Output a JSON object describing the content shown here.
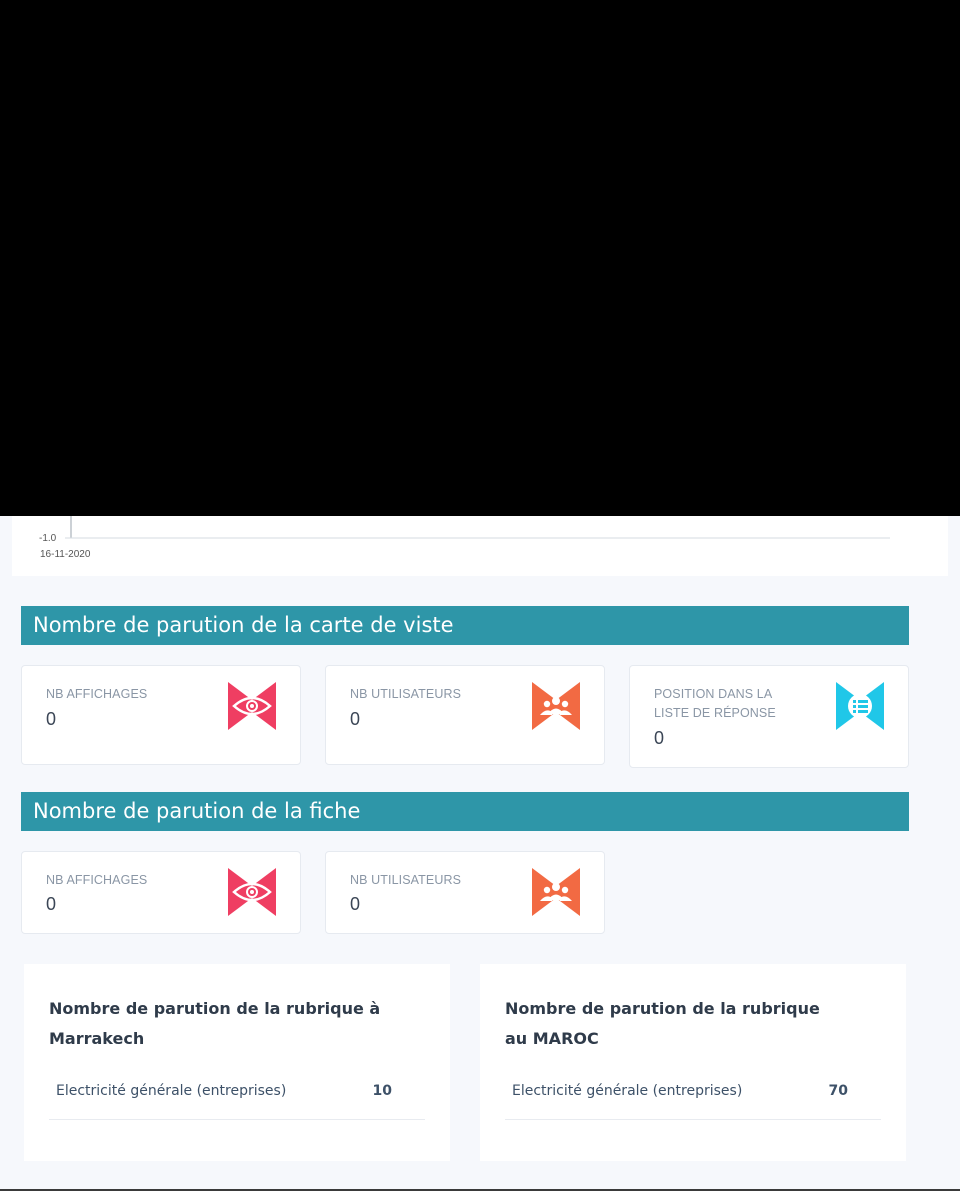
{
  "chart": {
    "y_tick_label": "-1.0",
    "x_tick_label": "16-11-2020"
  },
  "chart_data": {
    "type": "line",
    "x": [
      "16-11-2020"
    ],
    "series": [],
    "yticks": [
      -1.0
    ]
  },
  "section_carte": {
    "title": "Nombre de parution de la carte de viste",
    "cards": [
      {
        "label": "NB AFFICHAGES",
        "value": "0",
        "icon": "eye-icon",
        "color": "#ef3e62"
      },
      {
        "label": "NB UTILISATEURS",
        "value": "0",
        "icon": "users-icon",
        "color": "#f26a43"
      },
      {
        "label": "POSITION DANS LA LISTE DE RÉPONSE",
        "value": "0",
        "icon": "list-icon",
        "color": "#20c7e8"
      }
    ]
  },
  "section_fiche": {
    "title": "Nombre de parution de la fiche",
    "cards": [
      {
        "label": "NB AFFICHAGES",
        "value": "0",
        "icon": "eye-icon",
        "color": "#ef3e62"
      },
      {
        "label": "NB UTILISATEURS",
        "value": "0",
        "icon": "users-icon",
        "color": "#f26a43"
      }
    ]
  },
  "rubrique_marrakech": {
    "title": "Nombre de parution de la rubrique à Marrakech",
    "rows": [
      {
        "name": "Electricité générale (entreprises)",
        "count": "10"
      }
    ]
  },
  "rubrique_maroc": {
    "title": "Nombre de parution de la rubrique au MAROC",
    "rows": [
      {
        "name": "Electricité générale (entreprises)",
        "count": "70"
      }
    ]
  },
  "colors": {
    "section_bar": "#2e96a8",
    "eye_icon": "#ef3e62",
    "users_icon": "#f26a43",
    "list_icon": "#20c7e8"
  }
}
